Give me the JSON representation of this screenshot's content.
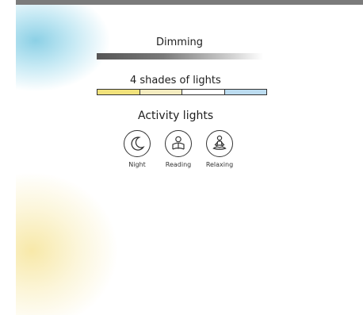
{
  "sections": {
    "dimming": {
      "title": "Dimming"
    },
    "shades": {
      "title": "4 shades of lights",
      "colors": [
        "#f1e27b",
        "#f4ecc0",
        "#ffffff",
        "#bcdcf0"
      ]
    },
    "activity": {
      "title": "Activity lights",
      "items": [
        {
          "label": "Night",
          "icon": "moon-icon"
        },
        {
          "label": "Reading",
          "icon": "reading-person-icon"
        },
        {
          "label": "Relaxing",
          "icon": "meditation-icon"
        }
      ]
    }
  }
}
